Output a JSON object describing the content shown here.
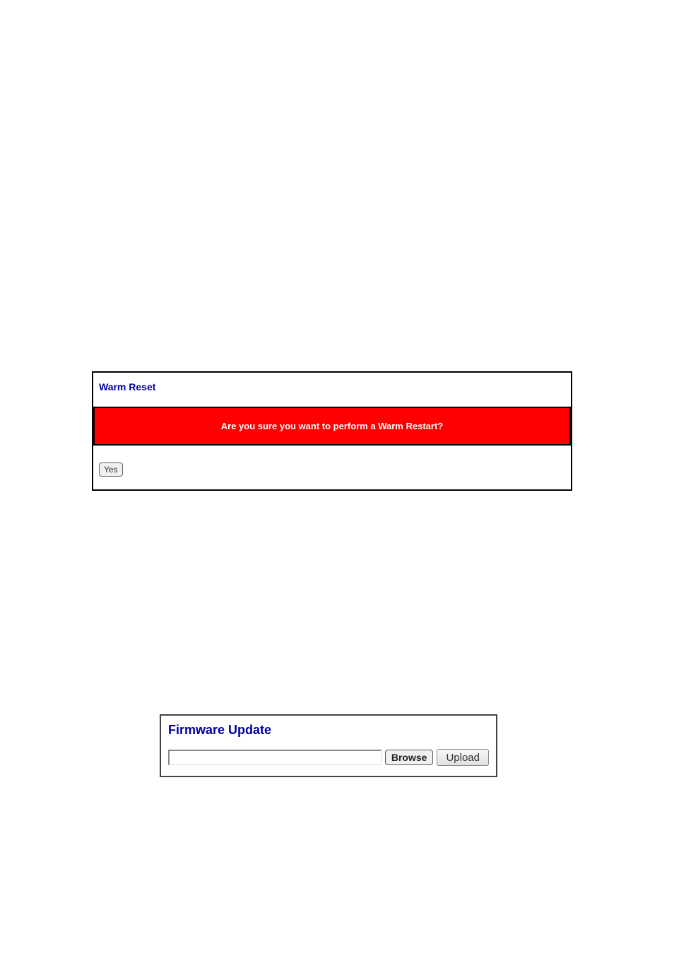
{
  "warm_reset": {
    "title": "Warm Reset",
    "banner": "Are you sure you want to perform a Warm Restart?",
    "yes_label": "Yes"
  },
  "firmware": {
    "title": "Firmware Update",
    "input_value": "",
    "browse_label": "Browse",
    "upload_label": "Upload"
  }
}
